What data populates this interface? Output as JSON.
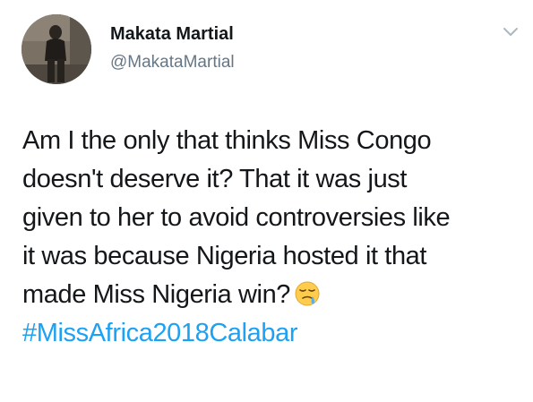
{
  "author": {
    "display_name": "Makata Martial",
    "handle": "@MakataMartial"
  },
  "icons": {
    "menu": "chevron-down-icon",
    "emoji": "sleepy-face-emoji-icon"
  },
  "tweet": {
    "lines": [
      "Am I the only that thinks Miss Congo",
      "doesn't deserve it?  That it was just",
      "given to her to avoid controversies like",
      "it was because Nigeria hosted it that",
      "made Miss Nigeria win?"
    ],
    "hashtag": "#MissAfrica2018Calabar"
  },
  "colors": {
    "text": "#14171a",
    "secondary": "#657786",
    "link": "#1da1f2"
  }
}
